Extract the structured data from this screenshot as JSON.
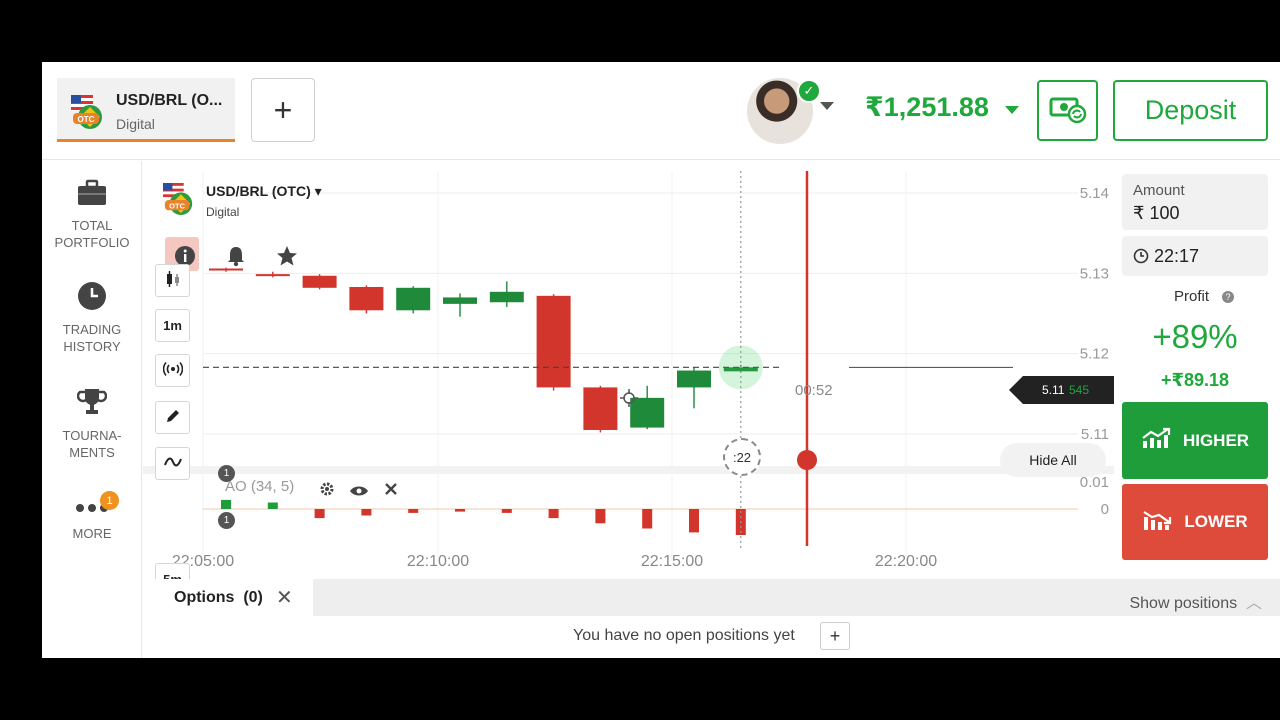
{
  "header": {
    "asset_name": "USD/BRL (O...",
    "asset_type": "Digital",
    "add_tab_label": "+",
    "balance": "₹1,251.88",
    "deposit_label": "Deposit"
  },
  "sidebar": {
    "items": [
      {
        "label": "TOTAL\nPORTFOLIO",
        "icon": "briefcase-icon"
      },
      {
        "label": "TRADING\nHISTORY",
        "icon": "clock-icon"
      },
      {
        "label": "TOURNA-\nMENTS",
        "icon": "trophy-icon"
      },
      {
        "label": "MORE",
        "icon": "more-icon",
        "badge": "1"
      }
    ]
  },
  "chart": {
    "asset_name": "USD/BRL (OTC)",
    "asset_type": "Digital",
    "timeframes": [
      "1m",
      "5m"
    ],
    "tool_badges": [
      "1",
      "1"
    ],
    "indicator_label": "AO (34, 5)",
    "hide_all_label": "Hide All",
    "countdown": ":22",
    "expiry_timer": "00:52",
    "current_price": "5.11",
    "current_price_suffix": "545",
    "colors": {
      "up": "#1f8a3a",
      "down": "#d2352b",
      "accent": "#1fa83c"
    }
  },
  "chart_data": {
    "type": "candlestick",
    "x_ticks": [
      "22:05:00",
      "22:10:00",
      "22:15:00",
      "22:20:00"
    ],
    "y_ticks": [
      "5.14",
      "5.13",
      "5.12",
      "5.11"
    ],
    "ao_ticks": [
      "0.01",
      "0"
    ],
    "candles": [
      {
        "open": 5.1306,
        "close": 5.1304,
        "high": 5.1307,
        "low": 5.1302
      },
      {
        "open": 5.1299,
        "close": 5.1297,
        "high": 5.1302,
        "low": 5.1295
      },
      {
        "open": 5.1297,
        "close": 5.1282,
        "high": 5.1299,
        "low": 5.128
      },
      {
        "open": 5.1283,
        "close": 5.1254,
        "high": 5.1285,
        "low": 5.125
      },
      {
        "open": 5.1254,
        "close": 5.1282,
        "high": 5.1284,
        "low": 5.125
      },
      {
        "open": 5.1262,
        "close": 5.127,
        "high": 5.1275,
        "low": 5.1246
      },
      {
        "open": 5.1264,
        "close": 5.1277,
        "high": 5.129,
        "low": 5.1258
      },
      {
        "open": 5.1272,
        "close": 5.1158,
        "high": 5.1274,
        "low": 5.1154
      },
      {
        "open": 5.1158,
        "close": 5.1105,
        "high": 5.116,
        "low": 5.1102
      },
      {
        "open": 5.1108,
        "close": 5.1145,
        "high": 5.116,
        "low": 5.1106
      },
      {
        "open": 5.1158,
        "close": 5.1179,
        "high": 5.1183,
        "low": 5.1132
      },
      {
        "open": 5.1178,
        "close": 5.1183,
        "high": 5.1186,
        "low": 5.1176
      }
    ],
    "ao_values": [
      0.0007,
      0.0005,
      -0.0007,
      -0.0005,
      -0.0003,
      -0.0002,
      -0.0003,
      -0.0007,
      -0.0011,
      -0.0015,
      -0.0018,
      -0.002
    ]
  },
  "trade": {
    "amount_label": "Amount",
    "amount_value": "₹ 100",
    "expiry_time": "22:17",
    "profit_label": "Profit",
    "profit_percent": "+89%",
    "profit_amount": "+₹89.18",
    "higher_label": "HIGHER",
    "lower_label": "LOWER"
  },
  "positions": {
    "tab_label": "Options",
    "tab_count": "(0)",
    "show_positions_label": "Show positions",
    "empty_text": "You have no open positions yet",
    "add_label": "+"
  }
}
